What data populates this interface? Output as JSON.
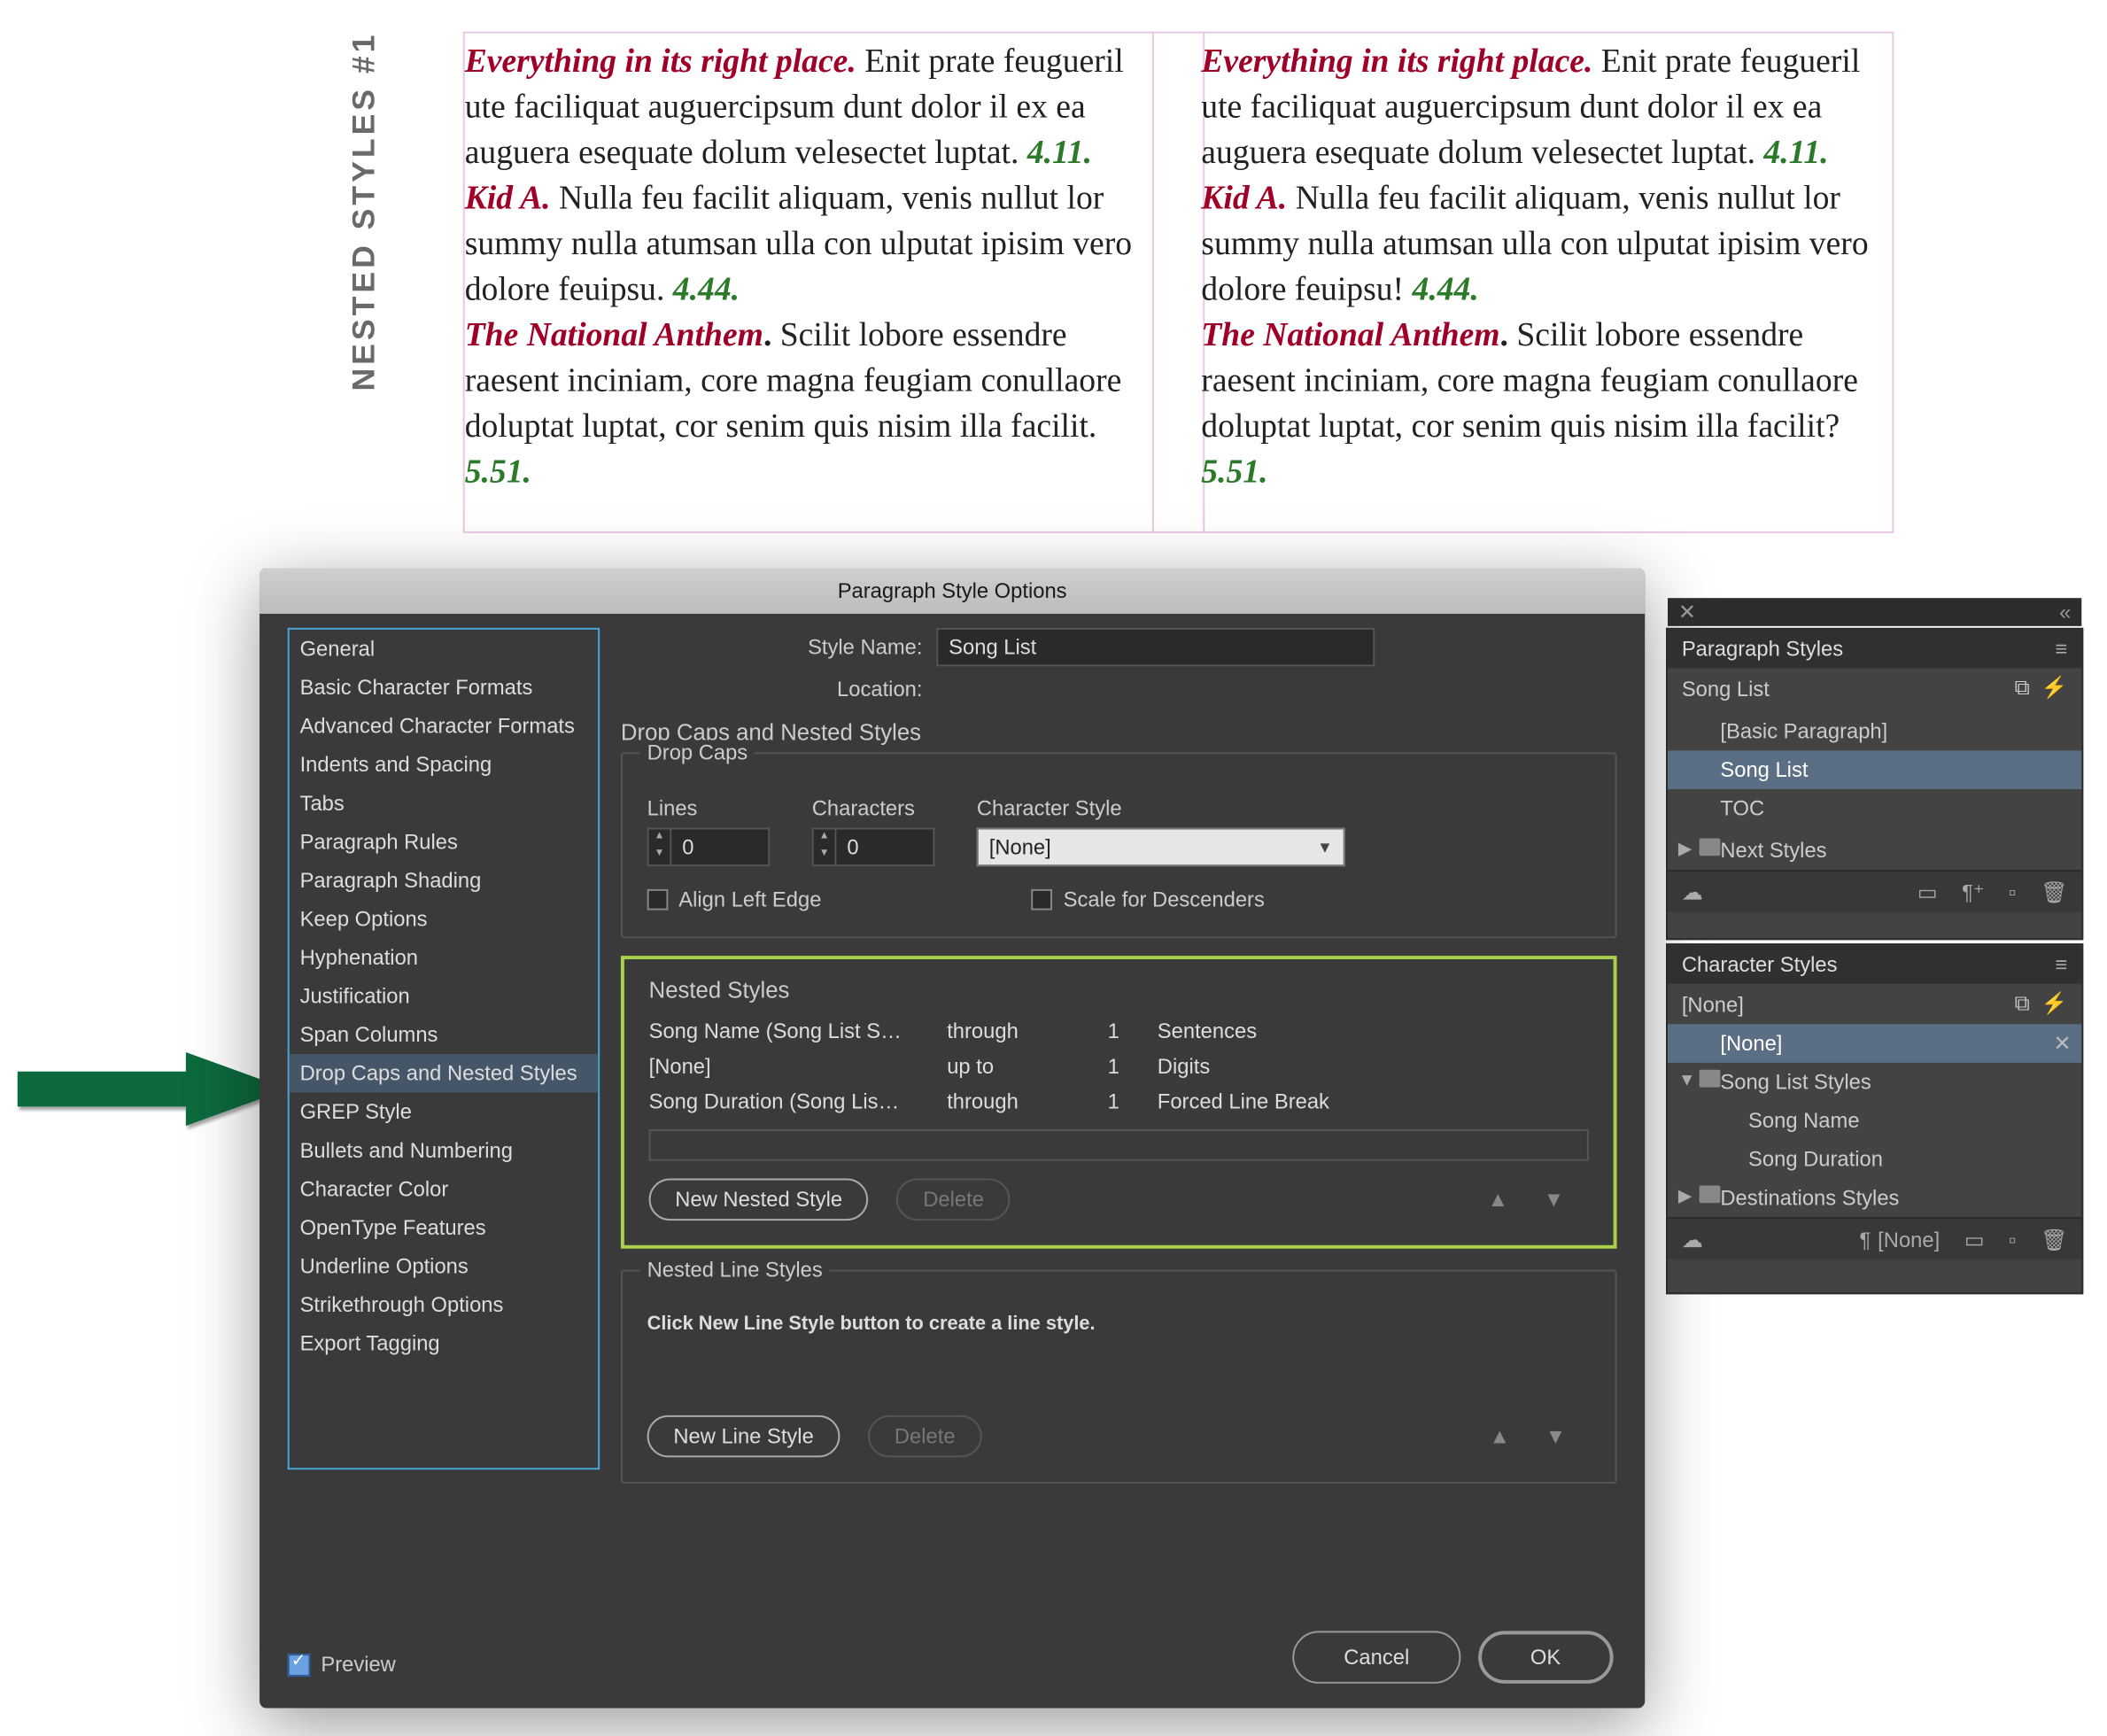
{
  "margin_label": "NESTED STYLES #1",
  "doc": {
    "p1": {
      "name": "Everything in its right place.",
      "body": " Enit prate feu­gueril ute faciliquat auguercipsum dunt do­lor il ex ea auguera esequate dolum velesectet luptat. ",
      "dur": "4.11."
    },
    "p2": {
      "name": "Kid A.",
      "body": " Nulla feu facilit aliquam, venis nullut lor summy nulla atumsan ulla con ulputat ipisim vero dolore feuipsu. ",
      "body_alt": " Nulla feu facilit aliquam, venis nullut lor summy nulla atumsan ulla con ulputat ipisim vero dolore feuipsu! ",
      "dur": "4.44."
    },
    "p3": {
      "name": "The National Anthem",
      "body": " Scilit lobore essendre raesent inciniam, core magna feugiam conul­laore doluptat luptat, cor senim quis nisim illa facilit. ",
      "body_alt": " Scilit lobore essendre raesent inciniam, core magna feugiam conul­laore doluptat luptat, cor senim quis nisim illa facilit? ",
      "dur": "5.51."
    }
  },
  "dialog": {
    "title": "Paragraph Style Options",
    "style_name_label": "Style Name:",
    "style_name": "Song List",
    "location_label": "Location:",
    "section": "Drop Caps and Nested Styles",
    "sidebar": [
      "General",
      "Basic Character Formats",
      "Advanced Character Formats",
      "Indents and Spacing",
      "Tabs",
      "Paragraph Rules",
      "Paragraph Shading",
      "Keep Options",
      "Hyphenation",
      "Justification",
      "Span Columns",
      "Drop Caps and Nested Styles",
      "GREP Style",
      "Bullets and Numbering",
      "Character Color",
      "OpenType Features",
      "Underline Options",
      "Strikethrough Options",
      "Export Tagging"
    ],
    "drop_caps": {
      "legend": "Drop Caps",
      "lines_label": "Lines",
      "lines": "0",
      "chars_label": "Characters",
      "chars": "0",
      "cstyle_label": "Character Style",
      "cstyle": "[None]",
      "align_left": "Align Left Edge",
      "scale_desc": "Scale for Descenders"
    },
    "nested": {
      "legend": "Nested Styles",
      "rows": [
        {
          "style": "Song Name (Song List S…",
          "mode": "through",
          "count": "1",
          "unit": "Sentences"
        },
        {
          "style": "[None]",
          "mode": "up to",
          "count": "1",
          "unit": "Digits"
        },
        {
          "style": "Song Duration (Song Lis…",
          "mode": "through",
          "count": "1",
          "unit": "Forced Line Break"
        }
      ],
      "new_btn": "New Nested Style",
      "delete_btn": "Delete"
    },
    "line_styles": {
      "legend": "Nested Line Styles",
      "hint": "Click New Line Style button to create a line style.",
      "new_btn": "New Line Style",
      "delete_btn": "Delete"
    },
    "preview": "Preview",
    "cancel": "Cancel",
    "ok": "OK"
  },
  "panels": {
    "para": {
      "title": "Paragraph Styles",
      "current": "Song List",
      "items": [
        "[Basic Paragraph]",
        "Song List",
        "TOC"
      ],
      "group": "Next Styles"
    },
    "char": {
      "title": "Character Styles",
      "current": "[None]",
      "none": "[None]",
      "group1": "Song List Styles",
      "g1_items": [
        "Song Name",
        "Song Duration"
      ],
      "group2": "Destinations Styles",
      "foot_none": "[None]"
    }
  }
}
